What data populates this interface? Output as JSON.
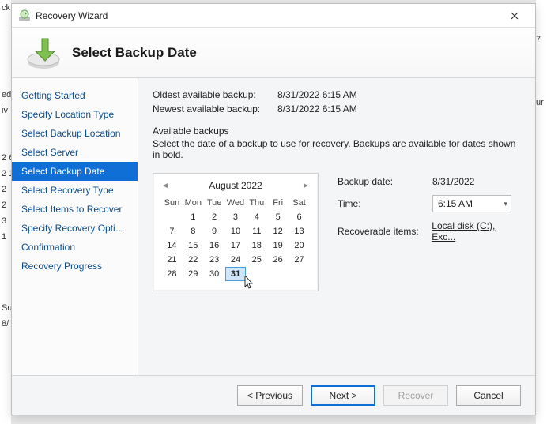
{
  "window": {
    "title": "Recovery Wizard",
    "heading": "Select Backup Date"
  },
  "sidebar": {
    "items": [
      {
        "label": "Getting Started"
      },
      {
        "label": "Specify Location Type"
      },
      {
        "label": "Select Backup Location"
      },
      {
        "label": "Select Server"
      },
      {
        "label": "Select Backup Date",
        "active": true
      },
      {
        "label": "Select Recovery Type"
      },
      {
        "label": "Select Items to Recover"
      },
      {
        "label": "Specify Recovery Options"
      },
      {
        "label": "Confirmation"
      },
      {
        "label": "Recovery Progress"
      }
    ]
  },
  "meta": {
    "oldest_label": "Oldest available backup:",
    "oldest_value": "8/31/2022 6:15 AM",
    "newest_label": "Newest available backup:",
    "newest_value": "8/31/2022 6:15 AM",
    "available_label": "Available backups",
    "available_desc": "Select the date of a backup to use for recovery. Backups are available for dates shown in bold."
  },
  "calendar": {
    "title": "August 2022",
    "weekdays": [
      "Sun",
      "Mon",
      "Tue",
      "Wed",
      "Thu",
      "Fri",
      "Sat"
    ],
    "weeks": [
      [
        "",
        "1",
        "2",
        "3",
        "4",
        "5",
        "6"
      ],
      [
        "7",
        "8",
        "9",
        "10",
        "11",
        "12",
        "13"
      ],
      [
        "14",
        "15",
        "16",
        "17",
        "18",
        "19",
        "20"
      ],
      [
        "21",
        "22",
        "23",
        "24",
        "25",
        "26",
        "27"
      ],
      [
        "28",
        "29",
        "30",
        "31",
        "",
        "",
        ""
      ]
    ],
    "selected": "31"
  },
  "details": {
    "backup_date_label": "Backup date:",
    "backup_date_value": "8/31/2022",
    "time_label": "Time:",
    "time_value": "6:15 AM",
    "recoverable_label": "Recoverable items:",
    "recoverable_link": "Local disk (C:), Exc..."
  },
  "footer": {
    "previous": "< Previous",
    "next": "Next >",
    "recover": "Recover",
    "cancel": "Cancel"
  },
  "bg_left": {
    "rows": [
      "ck",
      "ed",
      "iv",
      "",
      "2 6",
      "2 1",
      "2",
      "2",
      "3",
      "1",
      "",
      "",
      "",
      "Su",
      "8/"
    ]
  },
  "bg_right": {
    "rows": [
      "7",
      "",
      "",
      "ur"
    ]
  }
}
